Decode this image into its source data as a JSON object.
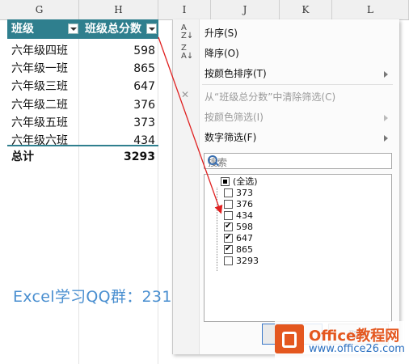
{
  "columns": [
    "G",
    "H",
    "I",
    "J",
    "K",
    "L"
  ],
  "table": {
    "header": {
      "class": "班级",
      "total": "班级总分数"
    },
    "rows": [
      {
        "name": "六年级四班",
        "score": "598"
      },
      {
        "name": "六年级一班",
        "score": "865"
      },
      {
        "name": "六年级三班",
        "score": "647"
      },
      {
        "name": "六年级二班",
        "score": "376"
      },
      {
        "name": "六年级五班",
        "score": "373"
      },
      {
        "name": "六年级六班",
        "score": "434"
      }
    ],
    "total_label": "总计",
    "total_value": "3293",
    "header_color": "#2f7f8e"
  },
  "watermark": "Excel学习QQ群：231768146",
  "menu": {
    "sort_asc": "升序(S)",
    "sort_desc": "降序(O)",
    "sort_by_color": "按颜色排序(T)",
    "clear_filter": "从“班级总分数”中清除筛选(C)",
    "filter_by_color": "按颜色筛选(I)",
    "number_filter": "数字筛选(F)",
    "search_placeholder": "搜索",
    "items": [
      {
        "label": "(全选)",
        "state": "partial"
      },
      {
        "label": "373",
        "state": "off"
      },
      {
        "label": "376",
        "state": "off"
      },
      {
        "label": "434",
        "state": "off"
      },
      {
        "label": "598",
        "state": "on"
      },
      {
        "label": "647",
        "state": "on"
      },
      {
        "label": "865",
        "state": "on"
      },
      {
        "label": "3293",
        "state": "off"
      }
    ],
    "ok_label": "",
    "cancel_label": "取消"
  },
  "logo": {
    "line1": "Office教程网",
    "line2": "www.office26.com"
  },
  "icons": {
    "sort_asc": "sort-az-icon",
    "sort_desc": "sort-za-icon",
    "clear": "clear-filter-icon",
    "search": "search-icon"
  }
}
